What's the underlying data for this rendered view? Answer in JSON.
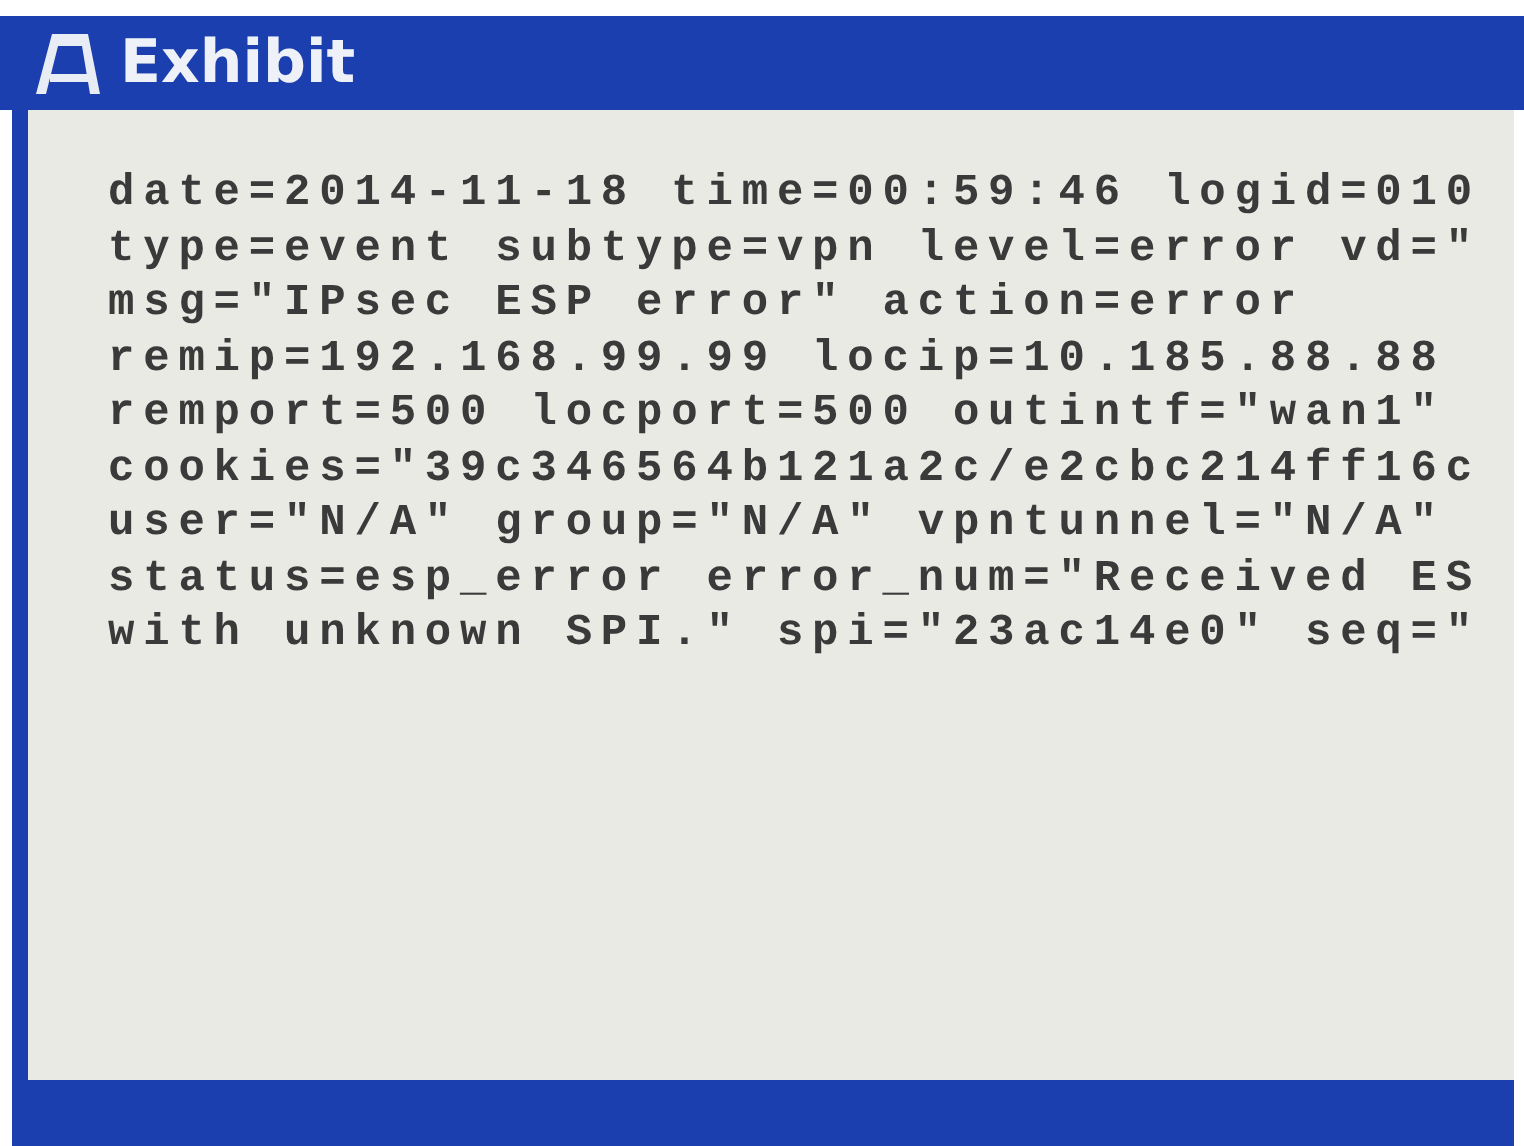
{
  "window": {
    "title": "Exhibit"
  },
  "log_lines": [
    "date=2014-11-18 time=00:59:46 logid=010",
    "type=event subtype=vpn level=error vd=\"",
    "msg=\"IPsec ESP error\" action=error",
    "remip=192.168.99.99 locip=10.185.88.88",
    "remport=500 locport=500 outintf=\"wan1\"",
    "cookies=\"39c346564b121a2c/e2cbc214ff16c",
    "user=\"N/A\" group=\"N/A\" vpntunnel=\"N/A\"",
    "status=esp_error error_num=\"Received ES",
    "with unknown SPI.\" spi=\"23ac14e0\" seq=\""
  ]
}
